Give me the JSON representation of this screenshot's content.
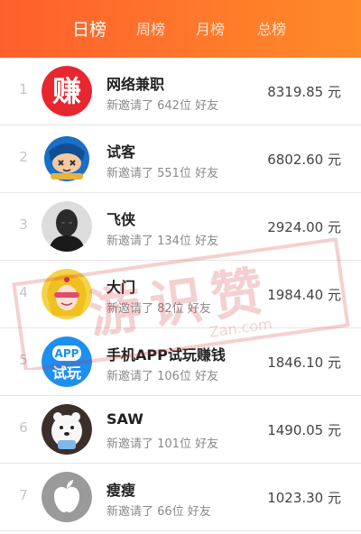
{
  "tabs": [
    {
      "label": "日榜",
      "active": true
    },
    {
      "label": "周榜",
      "active": false
    },
    {
      "label": "月榜",
      "active": false
    },
    {
      "label": "总榜",
      "active": false
    }
  ],
  "colors": {
    "header_gradient_start": "#ff5f2c",
    "header_gradient_end": "#ff8a28",
    "rank_gray": "#c4c4c4",
    "name_text": "#222222",
    "sub_text": "#8a8a8a"
  },
  "rows": [
    {
      "rank": "1",
      "name": "网络兼职",
      "invite": "新邀请了 642位 好友",
      "amount": "8319.85 元",
      "avatar_icon": "zhuan-logo-icon",
      "avatar_text": "赚"
    },
    {
      "rank": "2",
      "name": "试客",
      "invite": "新邀请了 551位 好友",
      "amount": "6802.60 元",
      "avatar_icon": "cartoon-ninja-icon"
    },
    {
      "rank": "3",
      "name": "飞侠",
      "invite": "新邀请了 134位 好友",
      "amount": "2924.00 元",
      "avatar_icon": "portrait-photo-icon"
    },
    {
      "rank": "4",
      "name": "大门",
      "invite": "新邀请了 82位 好友",
      "amount": "1984.40 元",
      "avatar_icon": "anime-girl-icon"
    },
    {
      "rank": "5",
      "name": "手机APP试玩赚钱",
      "invite": "新邀请了 106位 好友",
      "amount": "1846.10 元",
      "avatar_icon": "app-trial-logo-icon",
      "avatar_text_top": "APP",
      "avatar_text_bottom": "试玩"
    },
    {
      "rank": "6",
      "name": "SAW",
      "invite": "新邀请了 101位 好友",
      "amount": "1490.05 元",
      "avatar_icon": "polar-bear-icon"
    },
    {
      "rank": "7",
      "name": "瘦瘦",
      "invite": "新邀请了 66位 好友",
      "amount": "1023.30 元",
      "avatar_icon": "apple-logo-icon"
    }
  ],
  "watermark": {
    "text": "游识赞",
    "sub_text": "Zan.com"
  }
}
